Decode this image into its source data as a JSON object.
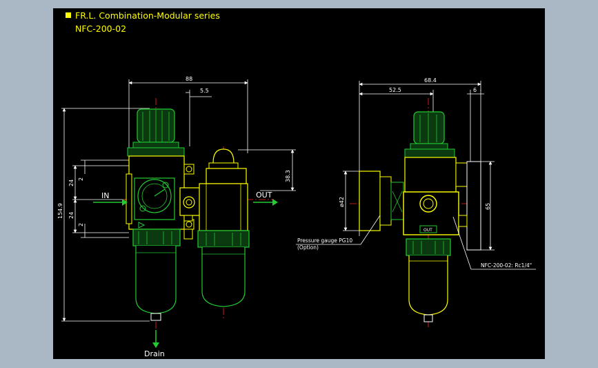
{
  "title": {
    "line1": "FR.L. Combination-Modular series",
    "line2": "NFC-200-02"
  },
  "colors": {
    "background": "#000000",
    "surround": "#aab8c6",
    "title_text": "#ffff00",
    "outline": "#ffff00",
    "body_green": "#22cc33",
    "dim_lines": "#ffffff",
    "centerline": "#ff2222",
    "arrow": "#22cc33"
  },
  "front_view": {
    "dims": {
      "width_top": "88",
      "offset_top": "5.5",
      "height_total": "154.9",
      "port_pitch_upper": "24",
      "port_pitch_lower": "24",
      "small_upper": "2",
      "small_lower": "2",
      "right_height": "38.3"
    },
    "labels": {
      "inlet": "IN",
      "outlet": "OUT",
      "drain": "Drain"
    }
  },
  "side_view": {
    "dims": {
      "width_top": "68.4",
      "offset_mid": "52.5",
      "offset_right": "6",
      "gauge_dia": "ø42",
      "height_right": "65"
    },
    "labels": {
      "gauge_line1": "Pressure gauge PG10",
      "gauge_line2": "(Option)",
      "port_spec": "NFC-200-02: Rc1/4\"",
      "out_badge": "OUT"
    }
  }
}
